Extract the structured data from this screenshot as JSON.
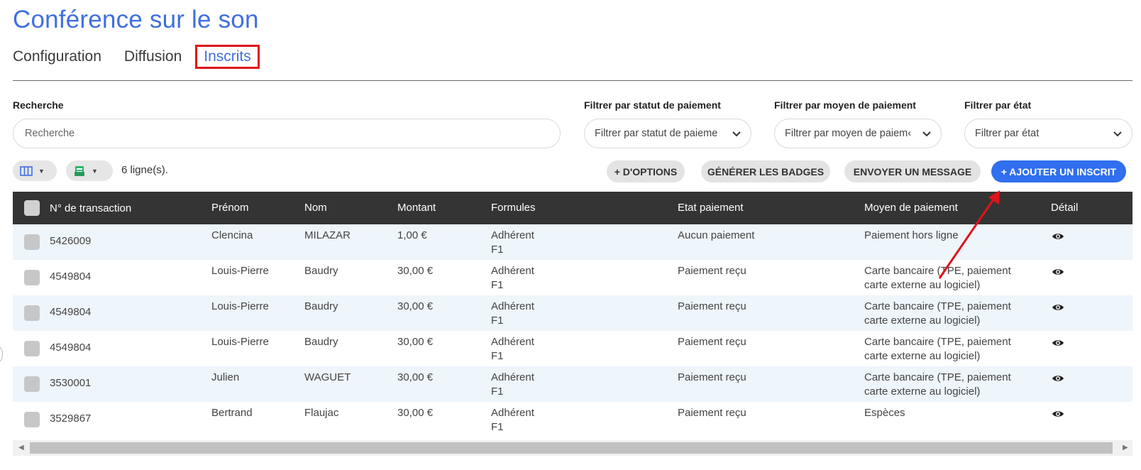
{
  "page": {
    "title": "Conférence sur le son"
  },
  "tabs": [
    {
      "label": "Configuration",
      "active": false
    },
    {
      "label": "Diffusion",
      "active": false
    },
    {
      "label": "Inscrits",
      "active": true
    }
  ],
  "filters": {
    "search_label": "Recherche",
    "search_placeholder": "Recherche",
    "payment_status_label": "Filtrer par statut de paiement",
    "payment_status_value": "Filtrer par statut de paieme",
    "payment_method_label": "Filtrer par moyen de paiement",
    "payment_method_value": "Filtrer par moyen de paiem‹",
    "state_label": "Filtrer par état",
    "state_value": "Filtrer par état"
  },
  "toolbar": {
    "row_count": "6 ligne(s).",
    "columns_icon": "columns-icon",
    "export_icon": "spreadsheet-export-icon",
    "more_options": "+ D'OPTIONS",
    "generate_badges": "GÉNÉRER LES BADGES",
    "send_message": "ENVOYER UN MESSAGE",
    "add_registrant": "+ AJOUTER UN INSCRIT"
  },
  "table": {
    "headers": [
      "N° de transaction",
      "Prénom",
      "Nom",
      "Montant",
      "Formules",
      "Etat paiement",
      "Moyen de paiement",
      "Détail"
    ],
    "rows": [
      {
        "transaction": "5426009",
        "first": "Clencina",
        "last": "MILAZAR",
        "amount": "1,00 €",
        "formula1": "Adhérent",
        "formula2": "F1",
        "state": "Aucun paiement",
        "method1": "Paiement hors ligne",
        "method2": ""
      },
      {
        "transaction": "4549804",
        "first": "Louis-Pierre",
        "last": "Baudry",
        "amount": "30,00 €",
        "formula1": "Adhérent",
        "formula2": "F1",
        "state": "Paiement reçu",
        "method1": "Carte bancaire (TPE, paiement",
        "method2": "carte externe au logiciel)"
      },
      {
        "transaction": "4549804",
        "first": "Louis-Pierre",
        "last": "Baudry",
        "amount": "30,00 €",
        "formula1": "Adhérent",
        "formula2": "F1",
        "state": "Paiement reçu",
        "method1": "Carte bancaire (TPE, paiement",
        "method2": "carte externe au logiciel)"
      },
      {
        "transaction": "4549804",
        "first": "Louis-Pierre",
        "last": "Baudry",
        "amount": "30,00 €",
        "formula1": "Adhérent",
        "formula2": "F1",
        "state": "Paiement reçu",
        "method1": "Carte bancaire (TPE, paiement",
        "method2": "carte externe au logiciel)"
      },
      {
        "transaction": "3530001",
        "first": "Julien",
        "last": "WAGUET",
        "amount": "30,00 €",
        "formula1": "Adhérent",
        "formula2": "F1",
        "state": "Paiement reçu",
        "method1": "Carte bancaire (TPE, paiement",
        "method2": "carte externe au logiciel)"
      },
      {
        "transaction": "3529867",
        "first": "Bertrand",
        "last": "Flaujac",
        "amount": "30,00 €",
        "formula1": "Adhérent",
        "formula2": "F1",
        "state": "Paiement reçu",
        "method1": "Espèces",
        "method2": ""
      }
    ],
    "detail_icon": "eye-icon"
  },
  "colors": {
    "accent": "#3f6fe0",
    "primary_button": "#2f6ff0",
    "highlight_box": "#e0131a",
    "header_bg": "#343434",
    "alt_row": "#eef5fb"
  }
}
